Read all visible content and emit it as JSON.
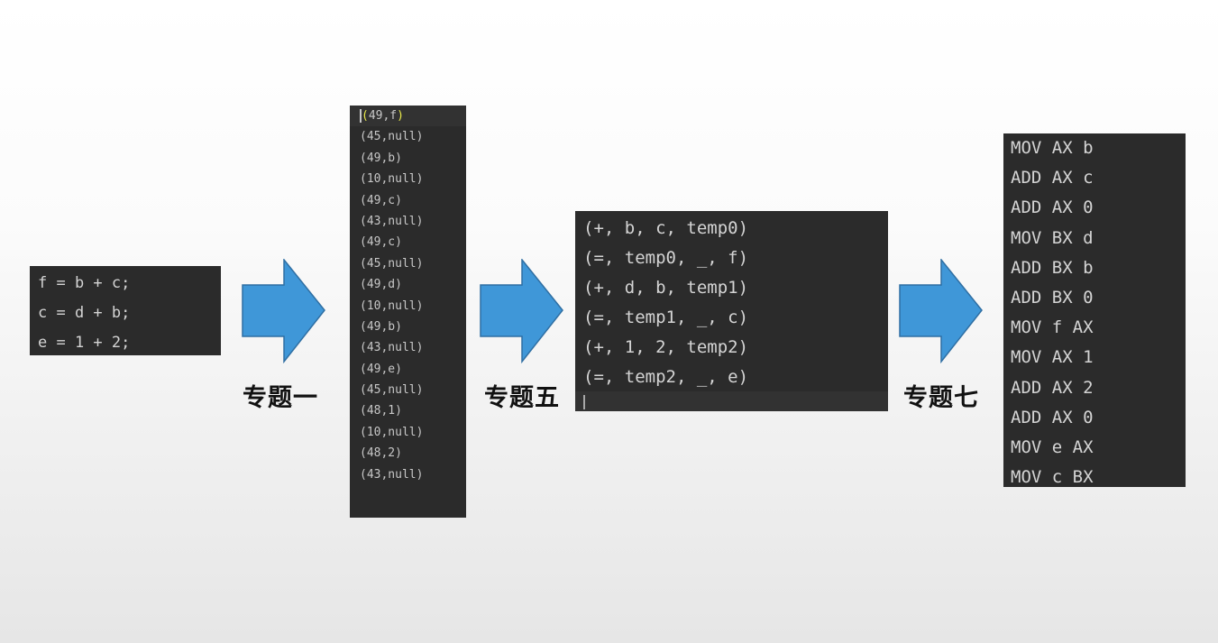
{
  "source_code": [
    "f = b + c;",
    "c = d + b;",
    "e = 1 + 2;"
  ],
  "tokens": [
    "(49,f)",
    "(45,null)",
    "(49,b)",
    "(10,null)",
    "(49,c)",
    "(43,null)",
    "(49,c)",
    "(45,null)",
    "(49,d)",
    "(10,null)",
    "(49,b)",
    "(43,null)",
    "(49,e)",
    "(45,null)",
    "(48,1)",
    "(10,null)",
    "(48,2)",
    "(43,null)"
  ],
  "quadruples": [
    "(+, b, c, temp0)",
    "(=, temp0, _, f)",
    "(+, d, b, temp1)",
    "(=, temp1, _, c)",
    "(+, 1, 2, temp2)",
    "(=, temp2, _, e)"
  ],
  "assembly": [
    "MOV AX b",
    "ADD AX c",
    "ADD AX 0",
    "MOV BX d",
    "ADD BX b",
    "ADD BX 0",
    "MOV f AX",
    "MOV AX 1",
    "ADD AX 2",
    "ADD AX 0",
    "MOV e AX",
    "MOV c BX"
  ],
  "stage_labels": [
    "专题一",
    "专题五",
    "专题七"
  ],
  "colors": {
    "arrow_fill": "#3f97d8",
    "arrow_stroke": "#2f6fa3",
    "panel_bg": "#2b2b2b",
    "code_text": "#d4d4d4",
    "bracket_highlight": "#e8e84a"
  }
}
